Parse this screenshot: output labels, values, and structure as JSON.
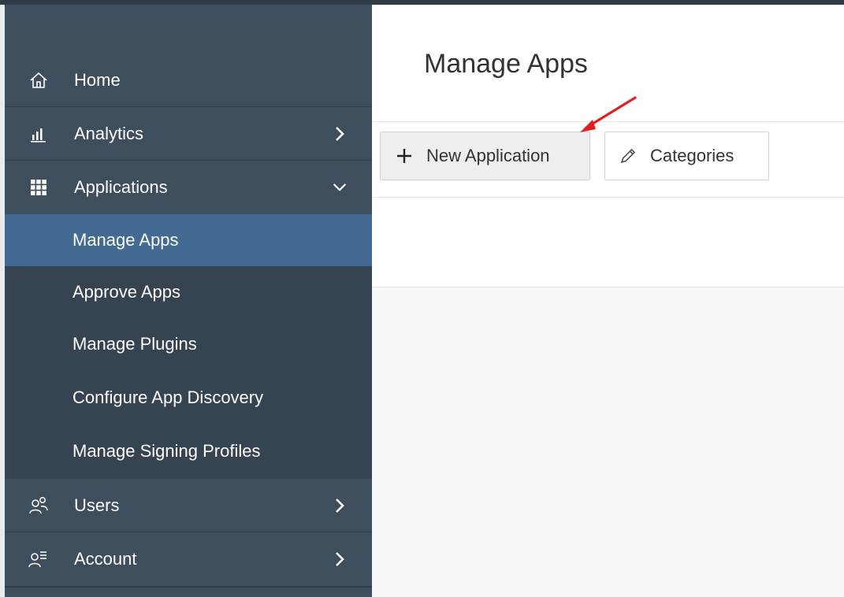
{
  "sidebar": {
    "items": [
      {
        "label": "Home",
        "icon": "home-icon"
      },
      {
        "label": "Analytics",
        "icon": "bar-chart-icon"
      },
      {
        "label": "Applications",
        "icon": "grid-icon"
      },
      {
        "label": "Users",
        "icon": "users-icon"
      },
      {
        "label": "Account",
        "icon": "account-icon"
      }
    ],
    "submenu": [
      {
        "label": "Manage Apps"
      },
      {
        "label": "Approve Apps"
      },
      {
        "label": "Manage Plugins"
      },
      {
        "label": "Configure App Discovery"
      },
      {
        "label": "Manage Signing Profiles"
      }
    ]
  },
  "main": {
    "title": "Manage Apps",
    "toolbar": {
      "new_application": "New Application",
      "categories": "Categories"
    }
  },
  "colors": {
    "sidebar_bg": "#3f4e5d",
    "submenu_bg": "#364451",
    "active_bg": "#426a92",
    "annotation_arrow": "#e02020"
  }
}
